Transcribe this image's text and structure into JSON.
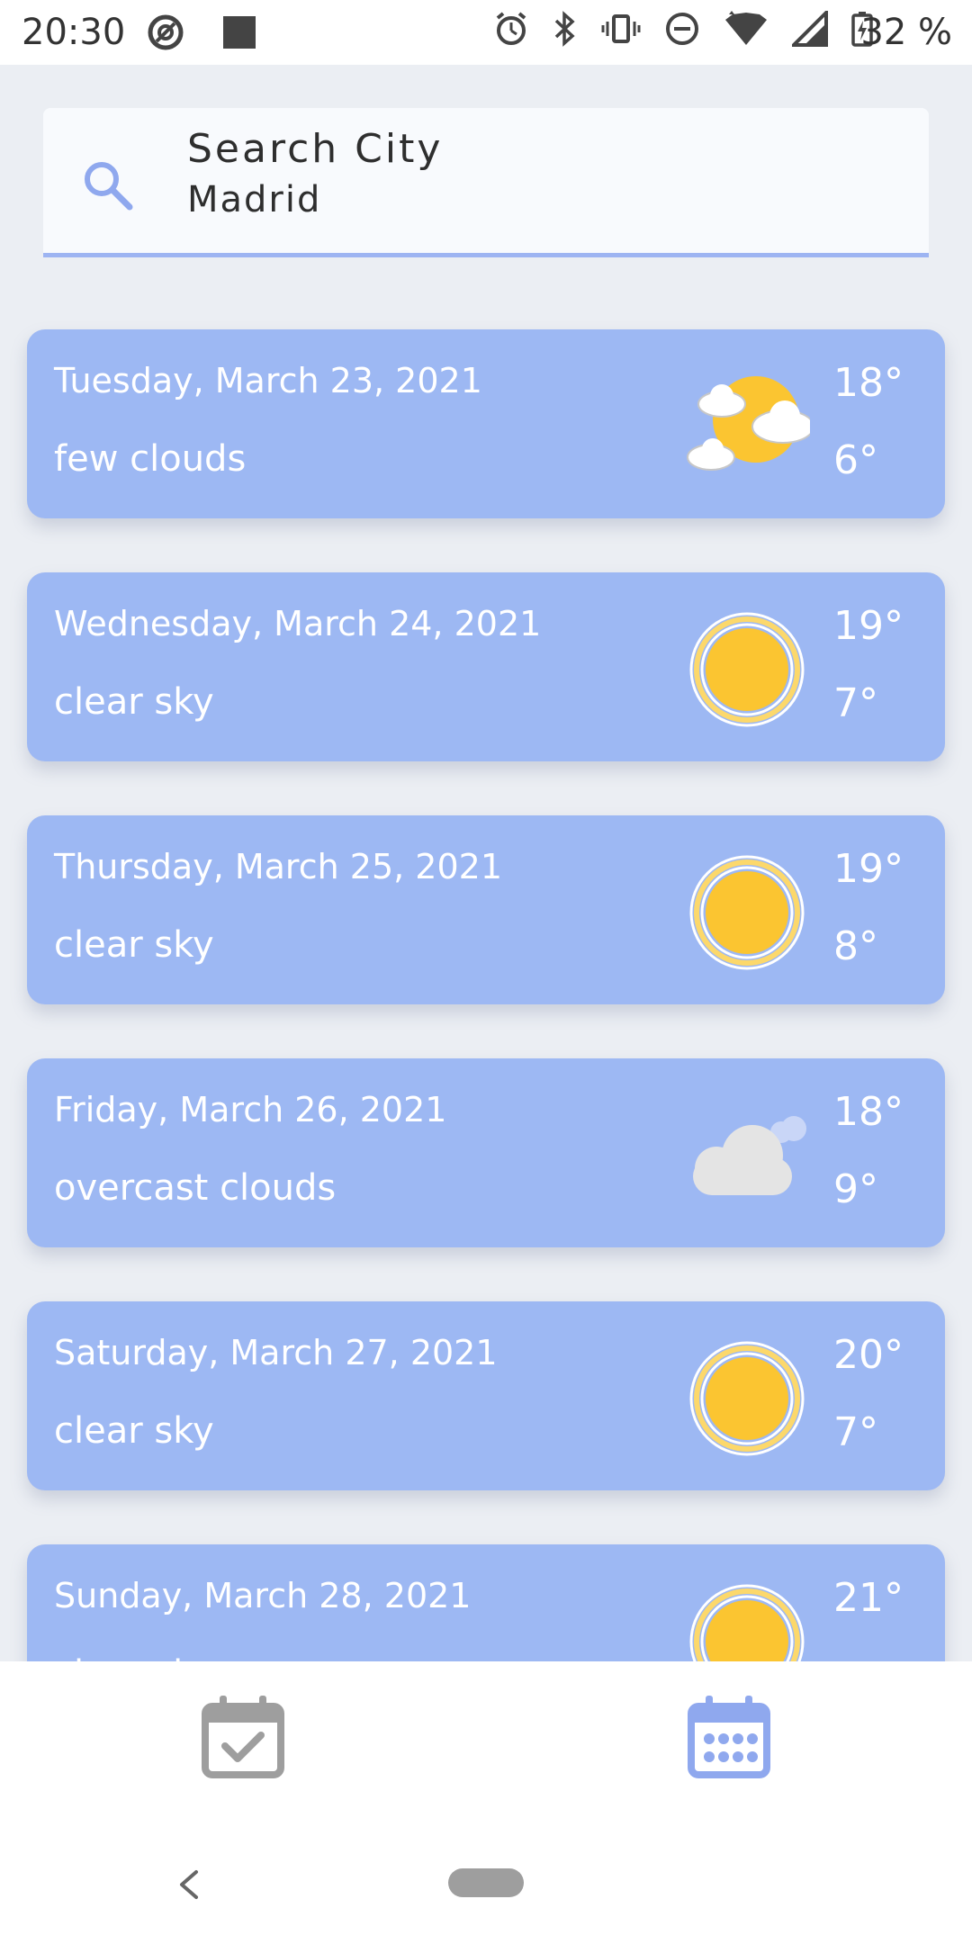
{
  "status_bar": {
    "time": "20:30",
    "battery": "32 %",
    "icons": [
      "at-sign-icon",
      "square-notification-icon",
      "alarm-icon",
      "bluetooth-icon",
      "vibrate-icon",
      "do-not-disturb-icon",
      "wifi-icon",
      "signal-icon",
      "battery-charging-icon"
    ]
  },
  "search": {
    "label": "Search City",
    "value": "Madrid",
    "icon": "search-icon"
  },
  "forecast": [
    {
      "date": "Tuesday, March 23, 2021",
      "description": "few clouds",
      "high": "18°",
      "low": "6°",
      "icon": "few-clouds-icon"
    },
    {
      "date": "Wednesday, March 24, 2021",
      "description": "clear sky",
      "high": "19°",
      "low": "7°",
      "icon": "clear-sky-icon"
    },
    {
      "date": "Thursday, March 25, 2021",
      "description": "clear sky",
      "high": "19°",
      "low": "8°",
      "icon": "clear-sky-icon"
    },
    {
      "date": "Friday, March 26, 2021",
      "description": "overcast clouds",
      "high": "18°",
      "low": "9°",
      "icon": "overcast-clouds-icon"
    },
    {
      "date": "Saturday, March 27, 2021",
      "description": "clear sky",
      "high": "20°",
      "low": "7°",
      "icon": "clear-sky-icon"
    },
    {
      "date": "Sunday, March 28, 2021",
      "description": "clear sky",
      "high": "21°",
      "low": "",
      "icon": "clear-sky-icon"
    }
  ],
  "bottom_nav": {
    "tabs": [
      {
        "icon": "calendar-check-icon",
        "active": false
      },
      {
        "icon": "calendar-grid-icon",
        "active": true
      }
    ]
  },
  "colors": {
    "card": "#9DB8F3",
    "accent": "#9DB4F2",
    "sun": "#FBC531",
    "background": "#EBEEF3",
    "inactive_icon": "#9E9E9E",
    "active_icon": "#8FA8EE"
  }
}
